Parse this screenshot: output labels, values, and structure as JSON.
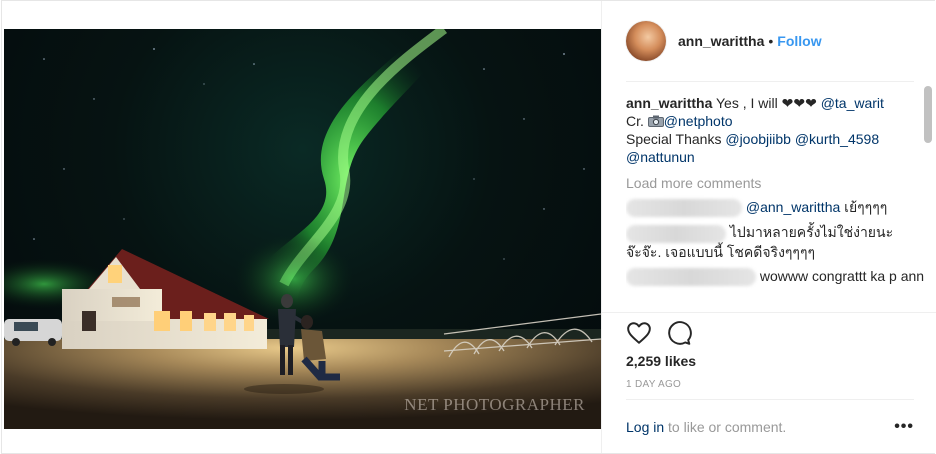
{
  "post": {
    "username": "ann_warittha",
    "separator": "•",
    "follow_label": "Follow",
    "photo": {
      "watermark": "NET PHOTOGRAPHER"
    },
    "caption": {
      "username": "ann_warittha",
      "text_1": " Yes , I will ❤❤❤ ",
      "mention_1": "@ta_warit",
      "credit_prefix": "Cr. ",
      "credit_icon": "camera-icon",
      "mention_2": "@netphoto",
      "thanks_prefix": "Special Thanks ",
      "mention_3": "@joobjiibb",
      "mention_4": "@kurth_4598",
      "mention_5": "@nattunun"
    },
    "load_more_label": "Load more comments",
    "comments": [
      {
        "mention": "@ann_warittha",
        "text": " เย้ๆๆๆๆ"
      },
      {
        "text_line_1": "ไปมาหลายครั้งไม่ใช่ง่ายนะ",
        "text_line_2": "จ๊ะจ๊ะ. เจอแบบนี้ โชคดีจริงๆๆๆๆ"
      },
      {
        "text": "wowww congrattt ka p ann"
      }
    ],
    "likes_label": "2,259 likes",
    "time_label": "1 DAY AGO",
    "login": {
      "link_label": "Log in",
      "rest_label": " to like or comment.",
      "more_label": "•••"
    },
    "icons": {
      "like": "heart-icon",
      "comment": "comment-icon"
    },
    "colors": {
      "follow": "#3897f0",
      "mention": "#003569",
      "muted": "#999999"
    }
  }
}
